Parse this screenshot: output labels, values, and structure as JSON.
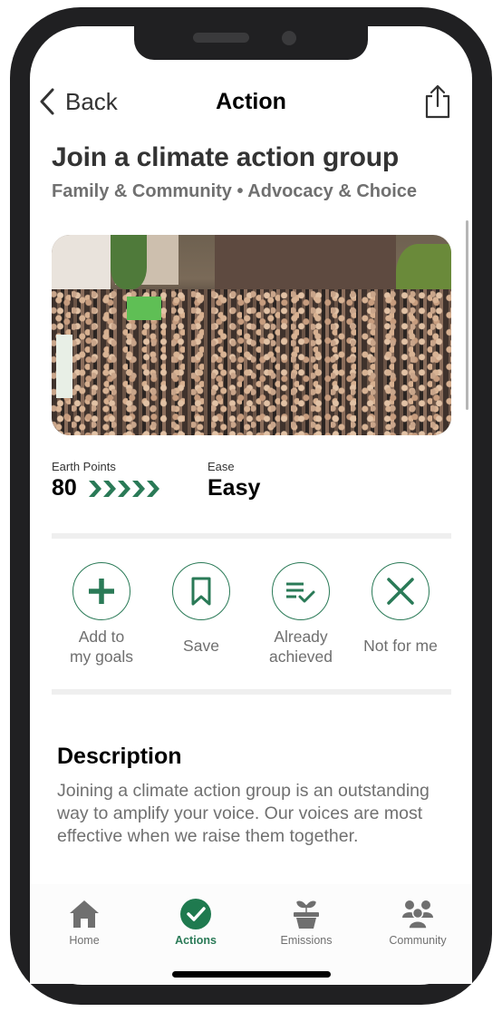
{
  "nav": {
    "back_label": "Back",
    "title": "Action",
    "share_icon": "share-icon"
  },
  "action": {
    "title": "Join a climate action group",
    "subtitle": "Family & Community • Advocacy & Choice",
    "image_alt": "Crowd at a climate protest in a city square"
  },
  "stats": {
    "earth_points_label": "Earth Points",
    "earth_points_value": "80",
    "earth_points_chevrons": 5,
    "ease_label": "Ease",
    "ease_value": "Easy"
  },
  "actions": [
    {
      "icon": "plus-icon",
      "label_line1": "Add to",
      "label_line2": "my goals"
    },
    {
      "icon": "bookmark-icon",
      "label_line1": "Save",
      "label_line2": ""
    },
    {
      "icon": "list-check-icon",
      "label_line1": "Already",
      "label_line2": "achieved"
    },
    {
      "icon": "x-icon",
      "label_line1": "Not for me",
      "label_line2": ""
    }
  ],
  "description": {
    "heading": "Description",
    "body": "Joining a climate action group is an outstanding way to amplify your voice. Our voices are most effective when we raise them together."
  },
  "tabs": [
    {
      "label": "Home",
      "icon": "home-icon",
      "active": false
    },
    {
      "label": "Actions",
      "icon": "check-circle-icon",
      "active": true
    },
    {
      "label": "Emissions",
      "icon": "plant-pot-icon",
      "active": false
    },
    {
      "label": "Community",
      "icon": "people-group-icon",
      "active": false
    }
  ],
  "colors": {
    "accent": "#2a7a57",
    "active_tab": "#1f7a4f",
    "inactive_icon": "#6f6f6f",
    "frame": "#202022"
  }
}
